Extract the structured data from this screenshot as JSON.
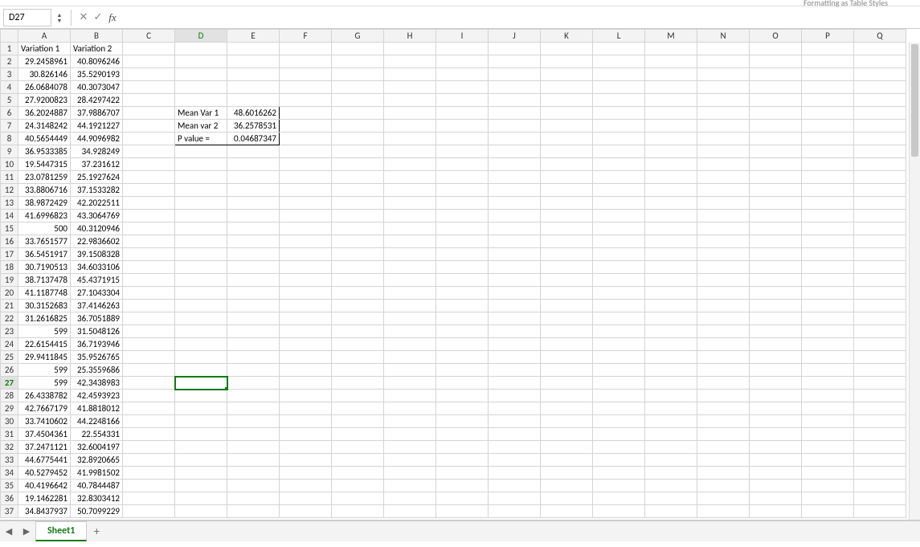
{
  "ribbon_remnant": "Formatting   as Table   Styles",
  "name_box": "D27",
  "formula": "",
  "columns": [
    "A",
    "B",
    "C",
    "D",
    "E",
    "F",
    "G",
    "H",
    "I",
    "J",
    "K",
    "L",
    "M",
    "N",
    "O",
    "P",
    "Q"
  ],
  "headers": {
    "A": "Variation 1",
    "B": "Variation 2"
  },
  "dataA": [
    "29.2458961",
    "30.826146",
    "26.0684078",
    "27.9200823",
    "36.2024887",
    "24.3148242",
    "40.5654449",
    "36.9533385",
    "19.5447315",
    "23.0781259",
    "33.8806716",
    "38.9872429",
    "41.6996823",
    "500",
    "33.7651577",
    "36.5451917",
    "30.7190513",
    "38.7137478",
    "41.1187748",
    "30.3152683",
    "31.2616825",
    "599",
    "22.6154415",
    "29.9411845",
    "599",
    "599",
    "26.4338782",
    "42.7667179",
    "33.7410602",
    "37.4504361",
    "37.2471121",
    "44.6775441",
    "40.5279452",
    "40.4196642",
    "19.1462281",
    "34.8437937"
  ],
  "dataB": [
    "40.8096246",
    "35.5290193",
    "40.3073047",
    "28.4297422",
    "37.9886707",
    "44.1921227",
    "44.9096982",
    "34.928249",
    "37.231612",
    "25.1927624",
    "37.1533282",
    "42.2022511",
    "43.3064769",
    "40.3120946",
    "22.9836602",
    "39.1508328",
    "34.6033106",
    "45.4371915",
    "27.1043304",
    "37.4146263",
    "36.7051889",
    "31.5048126",
    "36.7193946",
    "35.9526765",
    "25.3559686",
    "42.3438983",
    "42.4593923",
    "41.8818012",
    "44.2248166",
    "22.554331",
    "32.6004197",
    "32.8920665",
    "41.9981502",
    "40.7844487",
    "32.8303412",
    "50.7099229"
  ],
  "box": {
    "r6": {
      "D": "Mean Var 1",
      "E": "48.6016262"
    },
    "r7": {
      "D": "Mean var 2",
      "E": "36.2578531"
    },
    "r8": {
      "D": "P value =",
      "E": "0.04687347"
    }
  },
  "selected_cell": "D27",
  "sheet_tab": "Sheet1"
}
